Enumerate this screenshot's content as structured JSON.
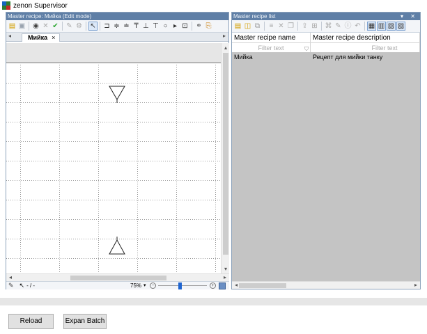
{
  "app": {
    "title": "zenon Supervisor"
  },
  "left_pane": {
    "header": "Master recipe: Мийка (Edit mode)",
    "toolbar_icons": [
      "new-icon",
      "save-icon",
      "sep",
      "view-icon",
      "cut-icon",
      "check-icon",
      "sep",
      "edit-icon",
      "settings-icon",
      "sep",
      "pointer-icon",
      "sep",
      "phase-icon",
      "parallel-start-icon",
      "parallel-end-icon",
      "alt-start-icon",
      "alt-end-icon",
      "transition-icon",
      "end-icon",
      "run-icon",
      "phase-box-icon",
      "sep",
      "link-icon",
      "export-icon"
    ],
    "tab_label": "Мийка",
    "tab_close": "×",
    "status": {
      "pointer": "- / -",
      "zoom": "75%"
    },
    "zoom_level": 0.45
  },
  "right_pane": {
    "header": "Master recipe list",
    "header_buttons": "▾ ✕",
    "columns": [
      {
        "name": "Master recipe name",
        "filter": "Filter text"
      },
      {
        "name": "Master recipe description",
        "filter": "Filter text"
      }
    ],
    "rows": [
      {
        "name": "Мийка",
        "description": "Рецепт для мийки танку"
      }
    ]
  },
  "buttons": {
    "reload": "Reload",
    "expand_batch": "Expan Batch"
  }
}
